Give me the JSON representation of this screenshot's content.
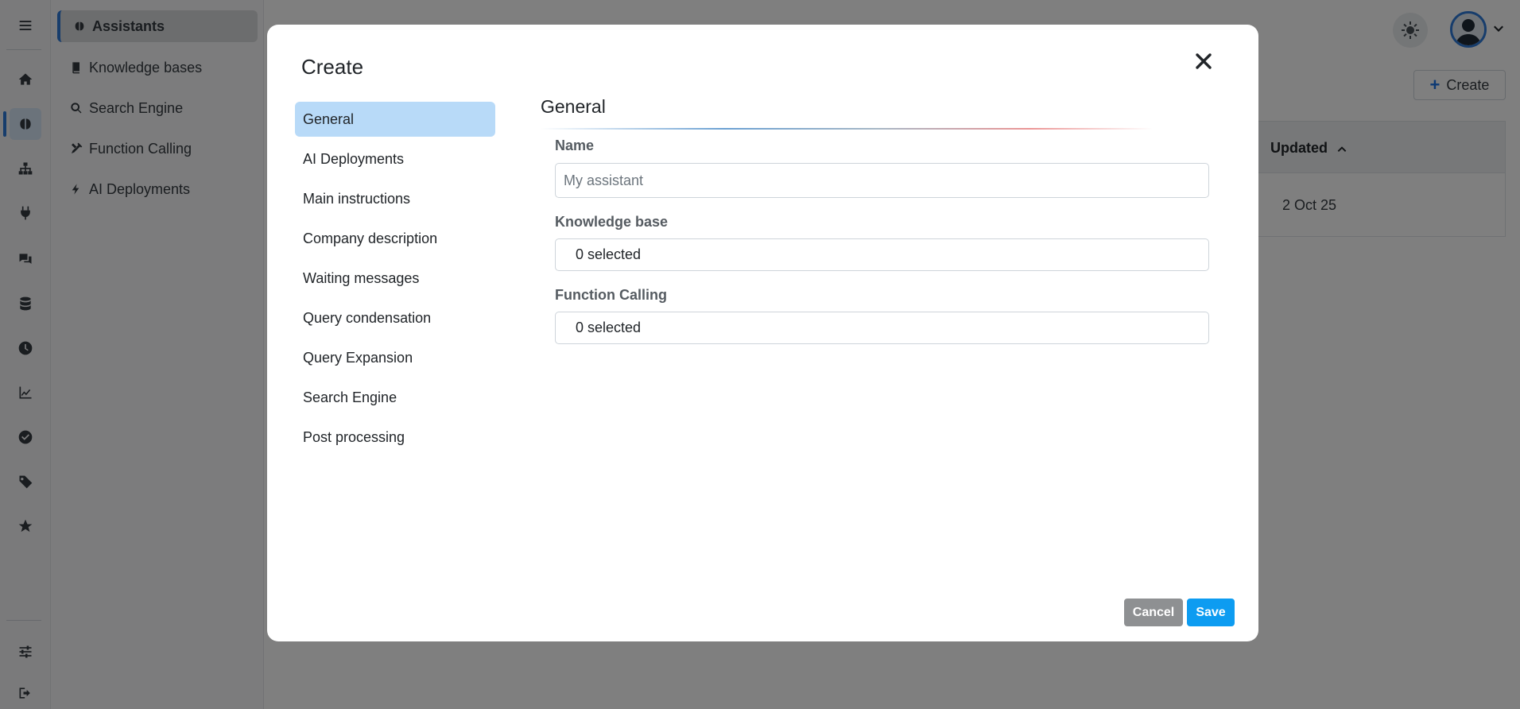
{
  "sidebar": {
    "rail_icons": [
      "menu-icon",
      "home-icon",
      "brain-icon",
      "sitemap-icon",
      "plug-icon",
      "chat-icon",
      "database-icon",
      "clock-icon",
      "chart-icon",
      "check-circle-icon",
      "tag-icon",
      "star-icon",
      "sliders-icon",
      "logout-icon"
    ],
    "items": [
      {
        "label": "Assistants",
        "icon": "brain-icon",
        "active": true
      },
      {
        "label": "Knowledge bases",
        "icon": "book-icon"
      },
      {
        "label": "Search Engine",
        "icon": "search-icon"
      },
      {
        "label": "Function Calling",
        "icon": "tools-icon"
      },
      {
        "label": "AI Deployments",
        "icon": "bolt-icon"
      }
    ]
  },
  "header": {
    "create_label": "Create"
  },
  "table": {
    "columns": [
      "Updated"
    ],
    "rows": [
      {
        "updated": "2 Oct 25"
      }
    ]
  },
  "modal": {
    "title": "Create",
    "tabs": [
      {
        "label": "General",
        "active": true
      },
      {
        "label": "AI Deployments"
      },
      {
        "label": "Main instructions"
      },
      {
        "label": "Company description"
      },
      {
        "label": "Waiting messages"
      },
      {
        "label": "Query condensation"
      },
      {
        "label": "Query Expansion"
      },
      {
        "label": "Search Engine"
      },
      {
        "label": "Post processing"
      }
    ],
    "section_title": "General",
    "fields": {
      "name_label": "Name",
      "name_value": "",
      "name_placeholder": "My assistant",
      "knowledge_base_label": "Knowledge base",
      "knowledge_base_value": "0 selected",
      "function_calling_label": "Function Calling",
      "function_calling_value": "0 selected"
    },
    "cancel_label": "Cancel",
    "save_label": "Save"
  },
  "colors": {
    "accent": "#2f7bd8",
    "tab_active": "#b8daf8",
    "save": "#0d9cf1",
    "cancel": "#8e9092",
    "overlay": "rgba(0,0,0,0.5)"
  }
}
